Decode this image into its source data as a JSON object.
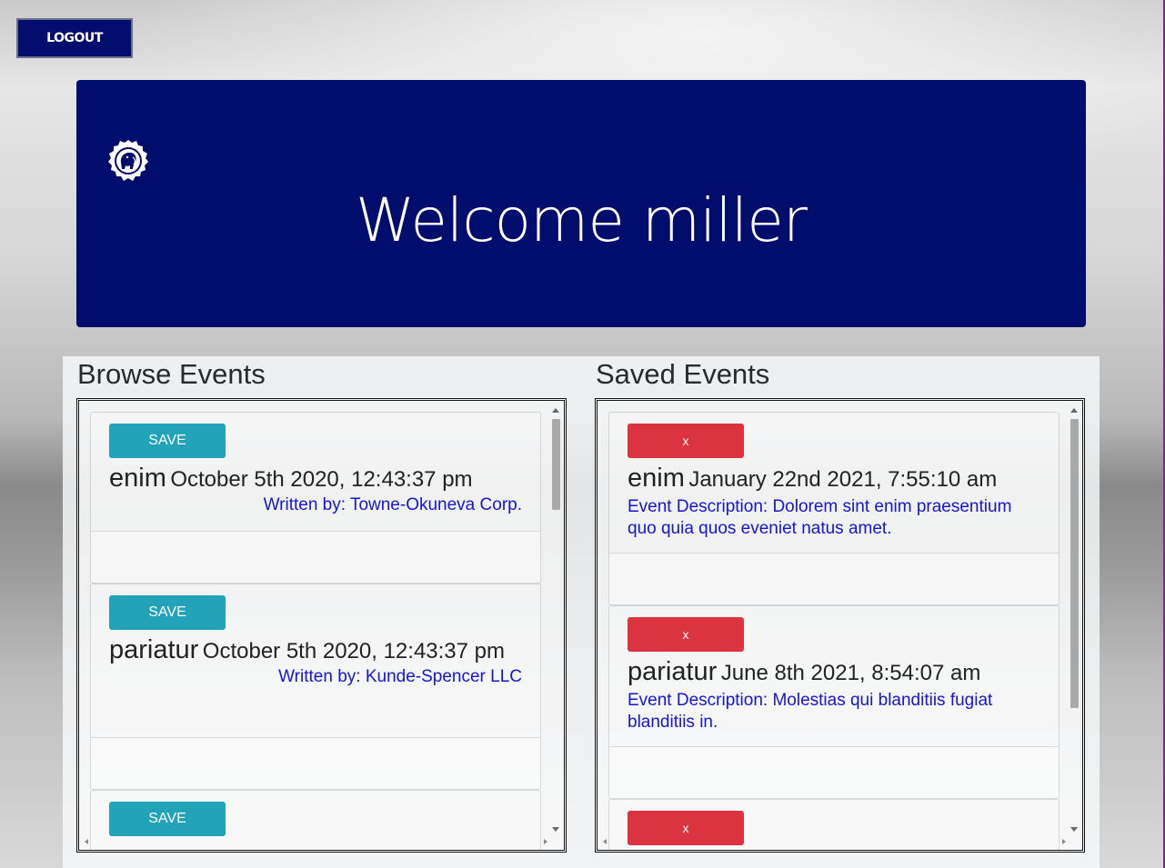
{
  "header": {
    "logout_label": "LOGOUT"
  },
  "banner": {
    "welcome_text": "Welcome miller",
    "logo_icon": "elephant-seal-icon"
  },
  "browse": {
    "title": "Browse Events",
    "save_label": "SAVE",
    "events": [
      {
        "name": "enim",
        "date": "October 5th 2020, 12:43:37 pm",
        "author": "Written by: Towne-Okuneva Corp."
      },
      {
        "name": "pariatur",
        "date": "October 5th 2020, 12:43:37 pm",
        "author": "Written by: Kunde-Spencer LLC"
      }
    ]
  },
  "saved": {
    "title": "Saved Events",
    "remove_label": "x",
    "events": [
      {
        "name": "enim",
        "date": "January 22nd 2021, 7:55:10 am",
        "description": "Event Description: Dolorem sint enim praesentium quo quia quos eveniet natus amet."
      },
      {
        "name": "pariatur",
        "date": "June 8th 2021, 8:54:07 am",
        "description": "Event Description: Molestias qui blanditiis fugiat blanditiis in."
      }
    ]
  },
  "colors": {
    "navy": "#000d6d",
    "save_button": "#22a3b8",
    "remove_button": "#db3340",
    "link_text": "#1515d4"
  }
}
